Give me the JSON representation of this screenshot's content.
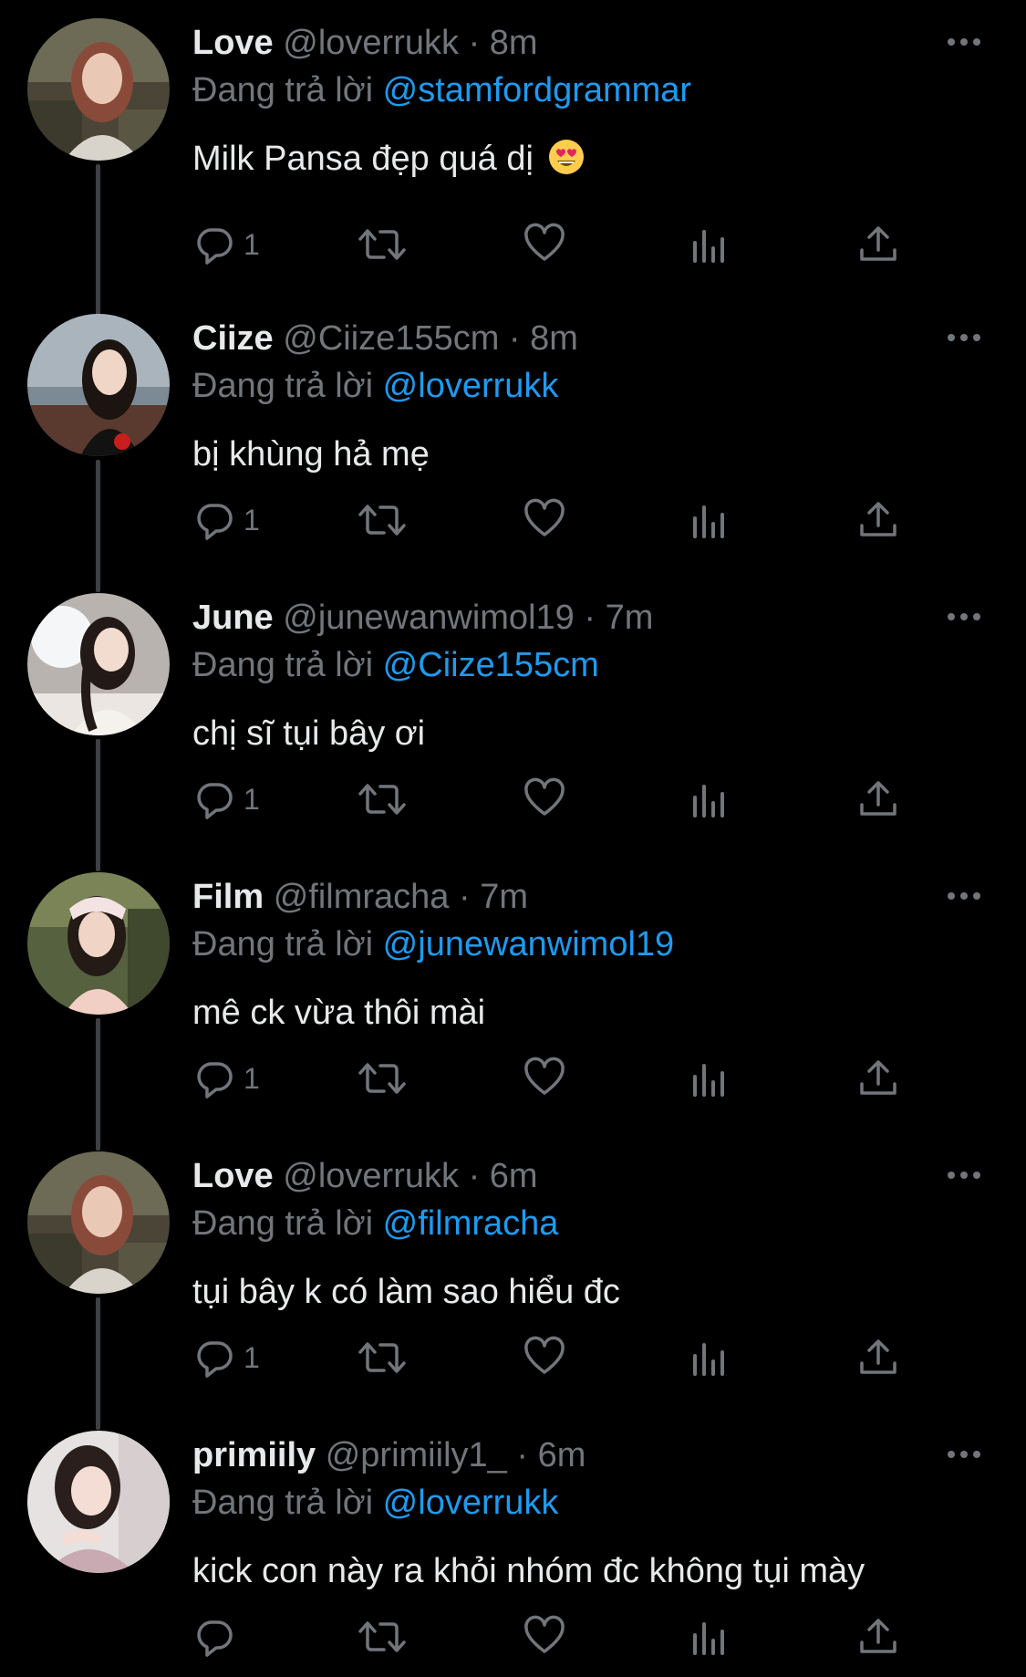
{
  "replying_prefix": "Đang trả lời",
  "colors": {
    "background": "#000000",
    "text": "#e7e9ea",
    "secondary": "#71767b",
    "accent": "#1d9bf0",
    "thread_line": "#3e4144"
  },
  "icons": {
    "reply": "reply-icon",
    "retweet": "retweet-icon",
    "like": "heart-icon",
    "views": "views-icon",
    "share": "share-icon",
    "more": "more-icon"
  },
  "tweets": [
    {
      "name": "Love",
      "handle": "@loverrukk",
      "separator": "·",
      "time": "8m",
      "reply_to": "@stamfordgrammar",
      "text": "Milk Pansa đẹp quá dị",
      "emoji": "heart-eyes-emoji",
      "reply_count": "1"
    },
    {
      "name": "Ciize",
      "handle": "@Ciize155cm",
      "separator": "·",
      "time": "8m",
      "reply_to": "@loverrukk",
      "text": "bị khùng hả mẹ",
      "reply_count": "1"
    },
    {
      "name": "June",
      "handle": "@junewanwimol19",
      "separator": "·",
      "time": "7m",
      "reply_to": "@Ciize155cm",
      "text": "chị sĩ tụi bây ơi",
      "reply_count": "1"
    },
    {
      "name": "Film",
      "handle": "@filmracha",
      "separator": "·",
      "time": "7m",
      "reply_to": "@junewanwimol19",
      "text": "mê ck vừa thôi mài",
      "reply_count": "1"
    },
    {
      "name": "Love",
      "handle": "@loverrukk",
      "separator": "·",
      "time": "6m",
      "reply_to": "@filmracha",
      "text": "tụi bây k có làm sao hiểu đc",
      "reply_count": "1"
    },
    {
      "name": "primiily",
      "handle": "@primiily1_",
      "separator": "·",
      "time": "6m",
      "reply_to": "@loverrukk",
      "text": "kick con này ra khỏi nhóm đc không tụi mày",
      "reply_count": ""
    }
  ]
}
